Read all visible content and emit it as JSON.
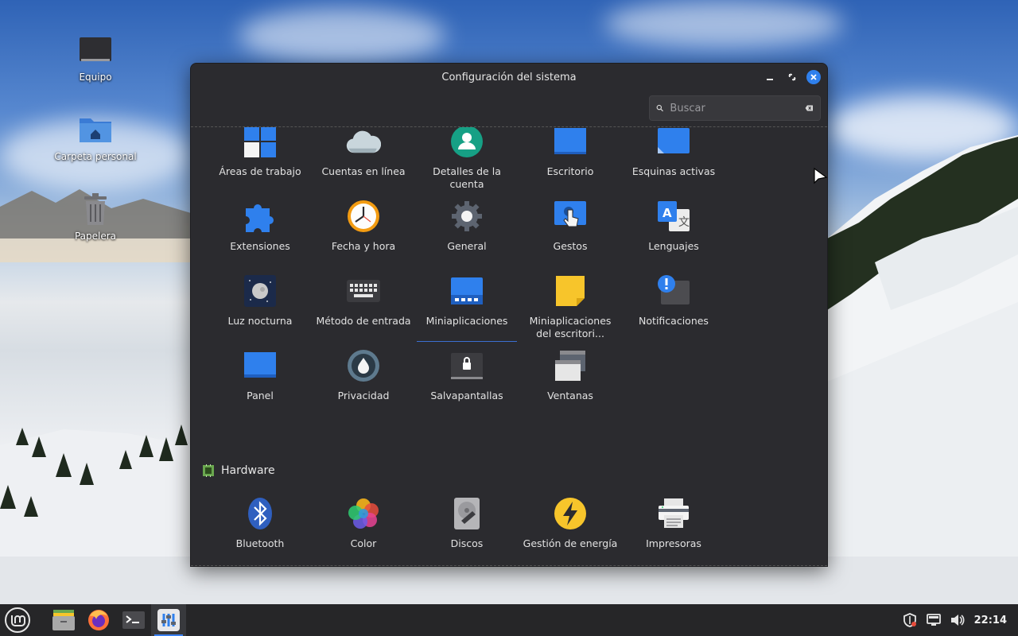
{
  "desktop": {
    "icons": [
      {
        "label": "Equipo",
        "icon": "computer-icon"
      },
      {
        "label": "Carpeta personal",
        "icon": "home-folder-icon"
      },
      {
        "label": "Papelera",
        "icon": "trash-icon"
      }
    ]
  },
  "window": {
    "title": "Configuración del sistema",
    "controls": {
      "minimize": "minimize-icon",
      "maximize": "maximize-icon",
      "close": "close-icon"
    },
    "search": {
      "placeholder": "Buscar",
      "value": ""
    }
  },
  "preferences": {
    "items": [
      {
        "label": "Áreas de trabajo",
        "icon": "workspaces-icon"
      },
      {
        "label": "Cuentas en línea",
        "icon": "cloud-icon"
      },
      {
        "label": "Detalles de la cuenta",
        "icon": "user-icon"
      },
      {
        "label": "Escritorio",
        "icon": "desktop-icon"
      },
      {
        "label": "Esquinas activas",
        "icon": "hot-corners-icon"
      },
      {
        "label": "Extensiones",
        "icon": "puzzle-icon"
      },
      {
        "label": "Fecha y hora",
        "icon": "clock-icon"
      },
      {
        "label": "General",
        "icon": "gear-icon"
      },
      {
        "label": "Gestos",
        "icon": "gestures-icon"
      },
      {
        "label": "Lenguajes",
        "icon": "language-icon"
      },
      {
        "label": "Luz nocturna",
        "icon": "night-light-icon"
      },
      {
        "label": "Método de entrada",
        "icon": "keyboard-icon"
      },
      {
        "label": "Miniaplicaciones",
        "icon": "applets-icon",
        "selected": true
      },
      {
        "label": "Miniaplicaciones del escritori...",
        "icon": "desklets-icon"
      },
      {
        "label": "Notificaciones",
        "icon": "notifications-icon"
      },
      {
        "label": "Panel",
        "icon": "panel-icon"
      },
      {
        "label": "Privacidad",
        "icon": "privacy-icon"
      },
      {
        "label": "Salvapantallas",
        "icon": "screensaver-icon"
      },
      {
        "label": "Ventanas",
        "icon": "windows-icon"
      }
    ]
  },
  "hardware": {
    "heading": "Hardware",
    "icon": "hardware-chip-icon",
    "items": [
      {
        "label": "Bluetooth",
        "icon": "bluetooth-icon"
      },
      {
        "label": "Color",
        "icon": "color-icon"
      },
      {
        "label": "Discos",
        "icon": "disks-icon"
      },
      {
        "label": "Gestión de energía",
        "icon": "power-icon"
      },
      {
        "label": "Impresoras",
        "icon": "printer-icon"
      }
    ]
  },
  "taskbar": {
    "apps": [
      {
        "name": "menu",
        "icon": "mint-menu-icon"
      },
      {
        "name": "files",
        "icon": "files-icon"
      },
      {
        "name": "firefox",
        "icon": "firefox-icon"
      },
      {
        "name": "terminal",
        "icon": "terminal-icon"
      },
      {
        "name": "settings",
        "icon": "settings-icon",
        "active": true
      }
    ],
    "tray": {
      "icons": [
        "shield-update-icon",
        "network-icon",
        "volume-icon"
      ],
      "clock": "22:14"
    }
  },
  "colors": {
    "window_bg": "#2b2b2f",
    "accent": "#2f80ed",
    "taskbar_bg": "#262628"
  }
}
